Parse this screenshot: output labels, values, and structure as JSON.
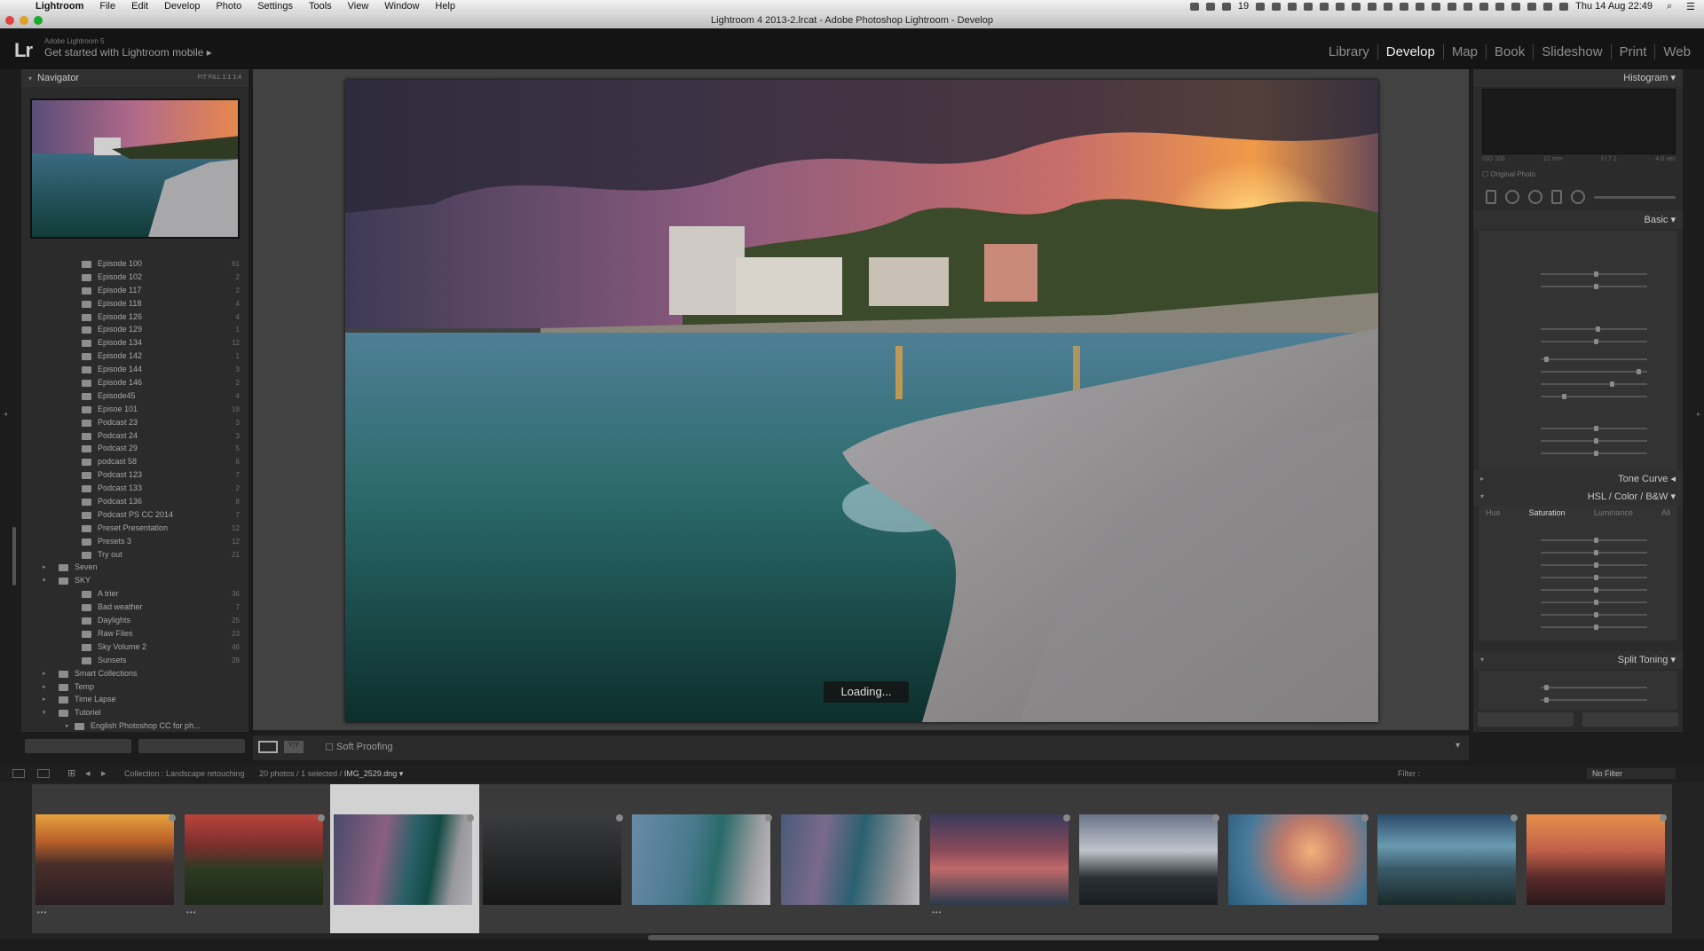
{
  "menubar": {
    "app": "Lightroom",
    "items": [
      "File",
      "Edit",
      "Develop",
      "Photo",
      "Settings",
      "Tools",
      "View",
      "Window",
      "Help"
    ],
    "tray_battery": "19",
    "clock": "Thu 14 Aug  22:49"
  },
  "window": {
    "title": "Lightroom 4 2013-2.lrcat - Adobe Photoshop Lightroom - Develop"
  },
  "identity": {
    "logo": "Lr",
    "small": "Adobe Lightroom 5",
    "main": "Get started with Lightroom mobile  ▸"
  },
  "modules": [
    "Library",
    "Develop",
    "Map",
    "Book",
    "Slideshow",
    "Print",
    "Web"
  ],
  "active_module": "Develop",
  "navigator": {
    "title": "Navigator",
    "zoom": "FIT   FILL   1:1   1:4"
  },
  "folders": [
    {
      "name": "Episode 100",
      "count": "61",
      "level": 3
    },
    {
      "name": "Episode 102",
      "count": "2",
      "level": 3
    },
    {
      "name": "Episode 117",
      "count": "2",
      "level": 3
    },
    {
      "name": "Episode 118",
      "count": "4",
      "level": 3
    },
    {
      "name": "Episode 126",
      "count": "4",
      "level": 3
    },
    {
      "name": "Episode 129",
      "count": "1",
      "level": 3
    },
    {
      "name": "Episode 134",
      "count": "12",
      "level": 3
    },
    {
      "name": "Episode 142",
      "count": "1",
      "level": 3
    },
    {
      "name": "Episode 144",
      "count": "3",
      "level": 3
    },
    {
      "name": "Episode 146",
      "count": "2",
      "level": 3
    },
    {
      "name": "Episode45",
      "count": "4",
      "level": 3
    },
    {
      "name": "Episoe 101",
      "count": "19",
      "level": 3
    },
    {
      "name": "Podcast 23",
      "count": "3",
      "level": 3
    },
    {
      "name": "Podcast 24",
      "count": "3",
      "level": 3
    },
    {
      "name": "Podcast 29",
      "count": "5",
      "level": 3
    },
    {
      "name": "podcast 58",
      "count": "6",
      "level": 3
    },
    {
      "name": "Podcast 123",
      "count": "7",
      "level": 3
    },
    {
      "name": "Podcast 133",
      "count": "2",
      "level": 3
    },
    {
      "name": "Podcast 136",
      "count": "8",
      "level": 3
    },
    {
      "name": "Podcast PS CC 2014",
      "count": "7",
      "level": 3
    },
    {
      "name": "Preset Presentation",
      "count": "12",
      "level": 3
    },
    {
      "name": "Presets 3",
      "count": "12",
      "level": 3
    },
    {
      "name": "Try out",
      "count": "21",
      "level": 3
    },
    {
      "name": "Seven",
      "count": "",
      "level": 1,
      "tri": "▸"
    },
    {
      "name": "SKY",
      "count": "",
      "level": 1,
      "tri": "▾"
    },
    {
      "name": "A trier",
      "count": "36",
      "level": 3
    },
    {
      "name": "Bad weather",
      "count": "7",
      "level": 3
    },
    {
      "name": "Daylights",
      "count": "25",
      "level": 3
    },
    {
      "name": "Raw Files",
      "count": "23",
      "level": 3
    },
    {
      "name": "Sky Volume 2",
      "count": "46",
      "level": 3
    },
    {
      "name": "Sunsets",
      "count": "28",
      "level": 3
    },
    {
      "name": "Smart Collections",
      "count": "",
      "level": 1,
      "tri": "▸"
    },
    {
      "name": "Temp",
      "count": "",
      "level": 1,
      "tri": "▸"
    },
    {
      "name": "Time Lapse",
      "count": "",
      "level": 1,
      "tri": "▸"
    },
    {
      "name": "Tutoriel",
      "count": "",
      "level": 1,
      "tri": "▾"
    },
    {
      "name": "English Photoshop CC for ph...",
      "count": "",
      "level": 2,
      "tri": "▸"
    }
  ],
  "center": {
    "loading": "Loading...",
    "soft_proofing": "Soft Proofing"
  },
  "right": {
    "histogram": "Histogram",
    "histo_info": [
      "ISO 100",
      "21 mm",
      "f / 7.1",
      "4.0 sec"
    ],
    "original_photo": "Original Photo",
    "basic": "Basic",
    "tone_curve": "Tone Curve",
    "hsl_header": "HSL  /  Color  /  B&W",
    "hsl_tabs": [
      "Hue",
      "Saturation",
      "Luminance",
      "All"
    ],
    "split_toning": "Split Toning"
  },
  "filmstrip": {
    "path": "Collection : Landscape retouching",
    "count": "20 photos / 1 selected /",
    "current_file": "IMG_2529.dng ▾",
    "filter_label": "Filter :",
    "filter_value": "No Filter"
  }
}
